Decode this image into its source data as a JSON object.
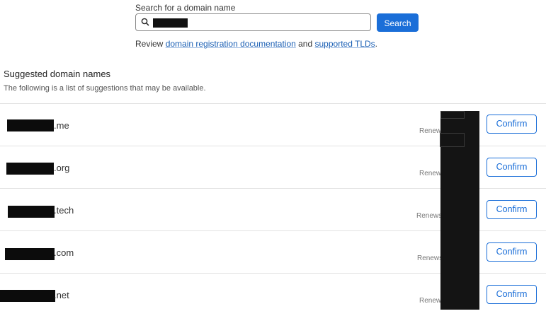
{
  "search": {
    "label": "Search for a domain name",
    "button_label": "Search"
  },
  "review": {
    "prefix": "Review ",
    "link1": "domain registration documentation",
    "middle": " and ",
    "link2": "supported TLDs",
    "suffix": "."
  },
  "suggestions": {
    "title": "Suggested domain names",
    "description": "The following is a list of suggestions that may be available.",
    "rows": [
      {
        "tld": ".me",
        "renew": "Renew",
        "confirm": "Confirm"
      },
      {
        "tld": ".org",
        "renew": "Renew",
        "confirm": "Confirm"
      },
      {
        "tld": ".tech",
        "renew": "Renews",
        "confirm": "Confirm"
      },
      {
        "tld": ".com",
        "renew": "Renews",
        "confirm": "Confirm"
      },
      {
        "tld": ".net",
        "renew": "Renew",
        "confirm": "Confirm"
      }
    ]
  },
  "colors": {
    "accent": "#1a6ed8",
    "link": "#1a5fb4",
    "redaction": "#0c0c0c"
  }
}
